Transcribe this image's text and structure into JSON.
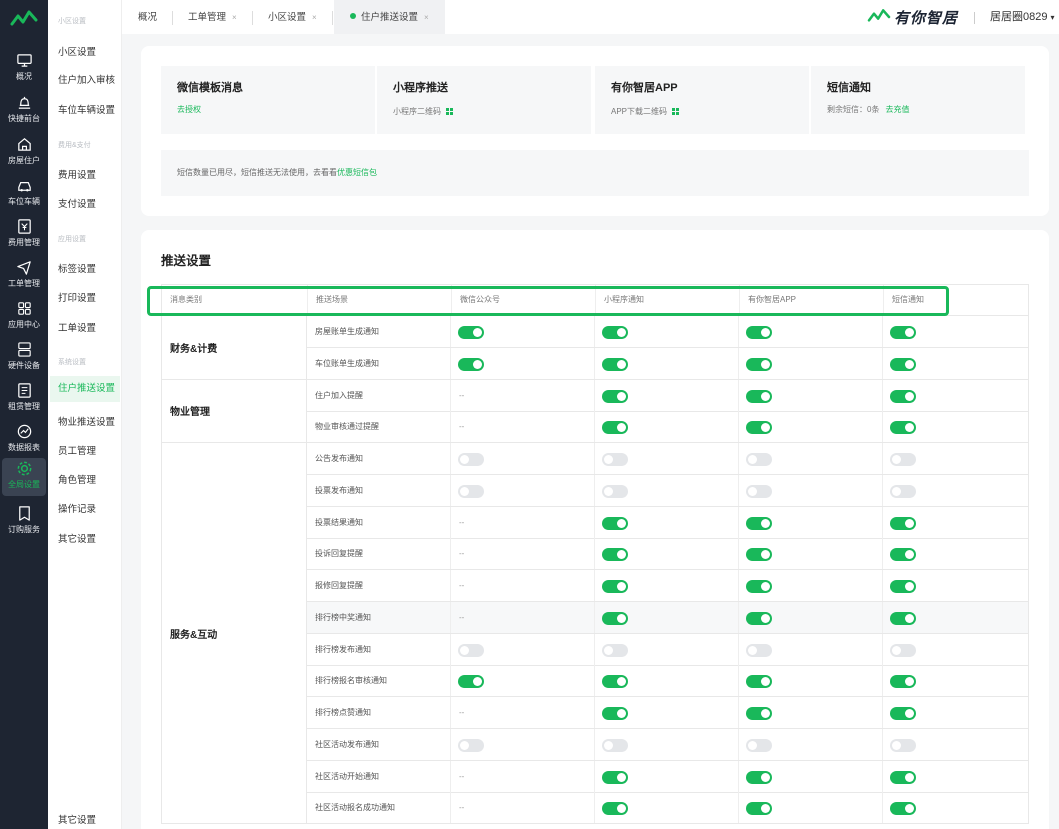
{
  "colors": {
    "accent": "#19b85a",
    "rail": "#1e2532"
  },
  "rail": [
    {
      "label": "概况",
      "icon": "monitor-icon",
      "active": false
    },
    {
      "label": "快捷前台",
      "icon": "bell-icon",
      "active": false
    },
    {
      "label": "房屋住户",
      "icon": "home-icon",
      "active": false
    },
    {
      "label": "车位车辆",
      "icon": "car-icon",
      "active": false
    },
    {
      "label": "费用管理",
      "icon": "yen-icon",
      "active": false
    },
    {
      "label": "工单管理",
      "icon": "send-icon",
      "active": false
    },
    {
      "label": "应用中心",
      "icon": "apps-icon",
      "active": false
    },
    {
      "label": "硬件设备",
      "icon": "device-icon",
      "active": false
    },
    {
      "label": "租赁管理",
      "icon": "document-icon",
      "active": false
    },
    {
      "label": "数据报表",
      "icon": "chart-icon",
      "active": false
    },
    {
      "label": "全局设置",
      "icon": "gear-icon",
      "active": true
    },
    {
      "label": "订购服务",
      "icon": "bookmark-icon",
      "active": false
    }
  ],
  "submenu": {
    "groups": [
      "小区设置",
      "费用&支付",
      "应用设置",
      "系统设置"
    ],
    "items": [
      "小区设置",
      "住户加入审核",
      "车位车辆设置",
      "费用设置",
      "支付设置",
      "标签设置",
      "打印设置",
      "工单设置",
      "住户推送设置",
      "物业推送设置",
      "员工管理",
      "角色管理",
      "操作记录",
      "其它设置",
      "其它设置"
    ]
  },
  "tabs": [
    {
      "label": "概况",
      "closable": false
    },
    {
      "label": "工单管理",
      "closable": true
    },
    {
      "label": "小区设置",
      "closable": true
    },
    {
      "label": "住户推送设置",
      "closable": true,
      "active": true
    }
  ],
  "brand": {
    "name": "有你智居"
  },
  "user": {
    "name": "居居圈0829"
  },
  "channels": [
    {
      "title": "微信模板消息",
      "link": "去授权"
    },
    {
      "title": "小程序推送",
      "sub": "小程序二维码"
    },
    {
      "title": "有你智居APP",
      "sub": "APP下载二维码"
    },
    {
      "title": "短信通知",
      "sub": "剩余短信：0条",
      "link": "去充值"
    }
  ],
  "notice": {
    "text": "短信数量已用尽，短信推送无法使用，去看看",
    "link": "优惠短信包"
  },
  "section_title": "推送设置",
  "table": {
    "headers": [
      "消息类别",
      "推送场景",
      "微信公众号",
      "小程序通知",
      "有你智居APP",
      "短信通知"
    ],
    "groups": [
      {
        "category": "财务&计费",
        "rows": [
          {
            "scene": "房屋账单生成通知",
            "values": [
              "on",
              "on",
              "on",
              "on"
            ]
          },
          {
            "scene": "车位账单生成通知",
            "values": [
              "on",
              "on",
              "on",
              "on"
            ]
          }
        ]
      },
      {
        "category": "物业管理",
        "rows": [
          {
            "scene": "住户加入提醒",
            "values": [
              "--",
              "on",
              "on",
              "on"
            ]
          },
          {
            "scene": "物业审核通过提醒",
            "values": [
              "--",
              "on",
              "on",
              "on"
            ]
          }
        ]
      },
      {
        "category": "服务&互动",
        "rows": [
          {
            "scene": "公告发布通知",
            "values": [
              "off",
              "off",
              "off",
              "off"
            ]
          },
          {
            "scene": "投票发布通知",
            "values": [
              "off",
              "off",
              "off",
              "off"
            ]
          },
          {
            "scene": "投票结果通知",
            "values": [
              "--",
              "on",
              "on",
              "on"
            ]
          },
          {
            "scene": "投诉回复提醒",
            "values": [
              "--",
              "on",
              "on",
              "on"
            ]
          },
          {
            "scene": "报修回复提醒",
            "values": [
              "--",
              "on",
              "on",
              "on"
            ]
          },
          {
            "scene": "排行榜中奖通知",
            "values": [
              "--",
              "on",
              "on",
              "on"
            ]
          },
          {
            "scene": "排行榜发布通知",
            "values": [
              "off",
              "off",
              "off",
              "off"
            ]
          },
          {
            "scene": "排行榜报名审核通知",
            "values": [
              "on",
              "on",
              "on",
              "on"
            ]
          },
          {
            "scene": "排行榜点赞通知",
            "values": [
              "--",
              "on",
              "on",
              "on"
            ]
          },
          {
            "scene": "社区活动发布通知",
            "values": [
              "off",
              "off",
              "off",
              "off"
            ]
          },
          {
            "scene": "社区活动开始通知",
            "values": [
              "--",
              "on",
              "on",
              "on"
            ]
          },
          {
            "scene": "社区活动报名成功通知",
            "values": [
              "--",
              "on",
              "on",
              "on"
            ]
          }
        ]
      }
    ]
  }
}
